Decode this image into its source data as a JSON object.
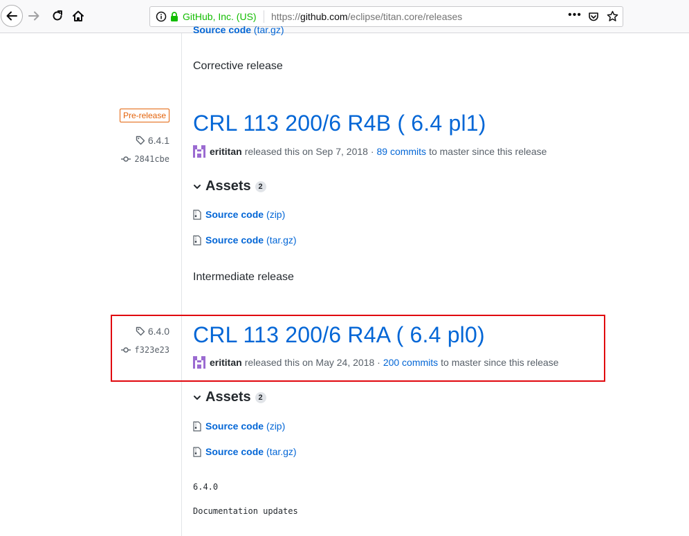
{
  "browser": {
    "identity": "GitHub, Inc. (US)",
    "url_prefix": "https://",
    "url_host": "github.com",
    "url_path": "/eclipse/titan.core/releases",
    "page_actions": "•••",
    "accent_secure": "#12bc00"
  },
  "top_release": {
    "asset_name": "Source code",
    "asset_ext": "(tar.gz)",
    "note": "Corrective release"
  },
  "release_1": {
    "badge": "Pre-release",
    "tag": "6.4.1",
    "commit": "2841cbe",
    "title": "CRL 113 200/6 R4B ( 6.4 pl1)",
    "author": "erititan",
    "released_text": "released this on Sep 7, 2018 ·",
    "commits_link": "89 commits",
    "since_text": "to master since this release",
    "assets_label": "Assets",
    "assets_count": "2",
    "assets": [
      {
        "name": "Source code",
        "ext": "(zip)"
      },
      {
        "name": "Source code",
        "ext": "(tar.gz)"
      }
    ],
    "note": "Intermediate release"
  },
  "release_2": {
    "tag": "6.4.0",
    "commit": "f323e23",
    "title": "CRL 113 200/6 R4A ( 6.4 pl0)",
    "author": "erititan",
    "released_text": "released this on May 24, 2018 ·",
    "commits_link": "200 commits",
    "since_text": "to master since this release",
    "assets_label": "Assets",
    "assets_count": "2",
    "assets": [
      {
        "name": "Source code",
        "ext": "(zip)"
      },
      {
        "name": "Source code",
        "ext": "(tar.gz)"
      }
    ],
    "body_lines": [
      "6.4.0",
      "Documentation updates"
    ]
  },
  "colors": {
    "link": "#0366d6",
    "prerelease": "#e36209",
    "highlight": "#e0060d"
  }
}
